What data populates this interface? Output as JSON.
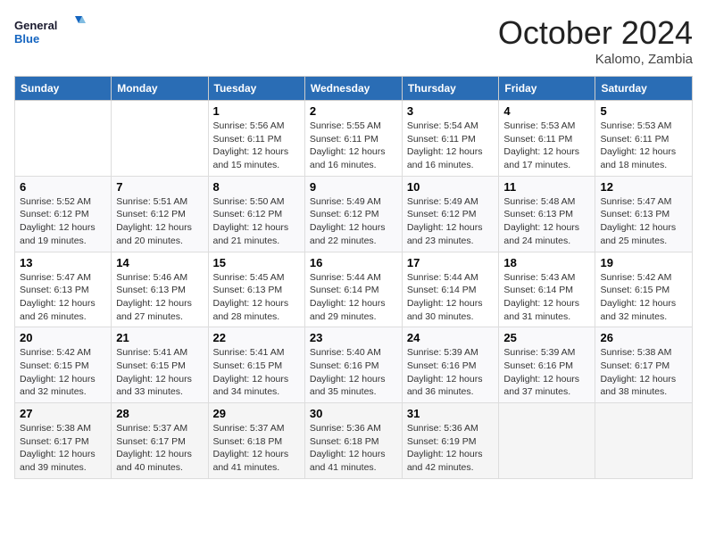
{
  "header": {
    "logo_general": "General",
    "logo_blue": "Blue",
    "month_title": "October 2024",
    "location": "Kalomo, Zambia"
  },
  "weekdays": [
    "Sunday",
    "Monday",
    "Tuesday",
    "Wednesday",
    "Thursday",
    "Friday",
    "Saturday"
  ],
  "weeks": [
    [
      {
        "day": "",
        "info": ""
      },
      {
        "day": "",
        "info": ""
      },
      {
        "day": "1",
        "info": "Sunrise: 5:56 AM\nSunset: 6:11 PM\nDaylight: 12 hours and 15 minutes."
      },
      {
        "day": "2",
        "info": "Sunrise: 5:55 AM\nSunset: 6:11 PM\nDaylight: 12 hours and 16 minutes."
      },
      {
        "day": "3",
        "info": "Sunrise: 5:54 AM\nSunset: 6:11 PM\nDaylight: 12 hours and 16 minutes."
      },
      {
        "day": "4",
        "info": "Sunrise: 5:53 AM\nSunset: 6:11 PM\nDaylight: 12 hours and 17 minutes."
      },
      {
        "day": "5",
        "info": "Sunrise: 5:53 AM\nSunset: 6:11 PM\nDaylight: 12 hours and 18 minutes."
      }
    ],
    [
      {
        "day": "6",
        "info": "Sunrise: 5:52 AM\nSunset: 6:12 PM\nDaylight: 12 hours and 19 minutes."
      },
      {
        "day": "7",
        "info": "Sunrise: 5:51 AM\nSunset: 6:12 PM\nDaylight: 12 hours and 20 minutes."
      },
      {
        "day": "8",
        "info": "Sunrise: 5:50 AM\nSunset: 6:12 PM\nDaylight: 12 hours and 21 minutes."
      },
      {
        "day": "9",
        "info": "Sunrise: 5:49 AM\nSunset: 6:12 PM\nDaylight: 12 hours and 22 minutes."
      },
      {
        "day": "10",
        "info": "Sunrise: 5:49 AM\nSunset: 6:12 PM\nDaylight: 12 hours and 23 minutes."
      },
      {
        "day": "11",
        "info": "Sunrise: 5:48 AM\nSunset: 6:13 PM\nDaylight: 12 hours and 24 minutes."
      },
      {
        "day": "12",
        "info": "Sunrise: 5:47 AM\nSunset: 6:13 PM\nDaylight: 12 hours and 25 minutes."
      }
    ],
    [
      {
        "day": "13",
        "info": "Sunrise: 5:47 AM\nSunset: 6:13 PM\nDaylight: 12 hours and 26 minutes."
      },
      {
        "day": "14",
        "info": "Sunrise: 5:46 AM\nSunset: 6:13 PM\nDaylight: 12 hours and 27 minutes."
      },
      {
        "day": "15",
        "info": "Sunrise: 5:45 AM\nSunset: 6:13 PM\nDaylight: 12 hours and 28 minutes."
      },
      {
        "day": "16",
        "info": "Sunrise: 5:44 AM\nSunset: 6:14 PM\nDaylight: 12 hours and 29 minutes."
      },
      {
        "day": "17",
        "info": "Sunrise: 5:44 AM\nSunset: 6:14 PM\nDaylight: 12 hours and 30 minutes."
      },
      {
        "day": "18",
        "info": "Sunrise: 5:43 AM\nSunset: 6:14 PM\nDaylight: 12 hours and 31 minutes."
      },
      {
        "day": "19",
        "info": "Sunrise: 5:42 AM\nSunset: 6:15 PM\nDaylight: 12 hours and 32 minutes."
      }
    ],
    [
      {
        "day": "20",
        "info": "Sunrise: 5:42 AM\nSunset: 6:15 PM\nDaylight: 12 hours and 32 minutes."
      },
      {
        "day": "21",
        "info": "Sunrise: 5:41 AM\nSunset: 6:15 PM\nDaylight: 12 hours and 33 minutes."
      },
      {
        "day": "22",
        "info": "Sunrise: 5:41 AM\nSunset: 6:15 PM\nDaylight: 12 hours and 34 minutes."
      },
      {
        "day": "23",
        "info": "Sunrise: 5:40 AM\nSunset: 6:16 PM\nDaylight: 12 hours and 35 minutes."
      },
      {
        "day": "24",
        "info": "Sunrise: 5:39 AM\nSunset: 6:16 PM\nDaylight: 12 hours and 36 minutes."
      },
      {
        "day": "25",
        "info": "Sunrise: 5:39 AM\nSunset: 6:16 PM\nDaylight: 12 hours and 37 minutes."
      },
      {
        "day": "26",
        "info": "Sunrise: 5:38 AM\nSunset: 6:17 PM\nDaylight: 12 hours and 38 minutes."
      }
    ],
    [
      {
        "day": "27",
        "info": "Sunrise: 5:38 AM\nSunset: 6:17 PM\nDaylight: 12 hours and 39 minutes."
      },
      {
        "day": "28",
        "info": "Sunrise: 5:37 AM\nSunset: 6:17 PM\nDaylight: 12 hours and 40 minutes."
      },
      {
        "day": "29",
        "info": "Sunrise: 5:37 AM\nSunset: 6:18 PM\nDaylight: 12 hours and 41 minutes."
      },
      {
        "day": "30",
        "info": "Sunrise: 5:36 AM\nSunset: 6:18 PM\nDaylight: 12 hours and 41 minutes."
      },
      {
        "day": "31",
        "info": "Sunrise: 5:36 AM\nSunset: 6:19 PM\nDaylight: 12 hours and 42 minutes."
      },
      {
        "day": "",
        "info": ""
      },
      {
        "day": "",
        "info": ""
      }
    ]
  ]
}
